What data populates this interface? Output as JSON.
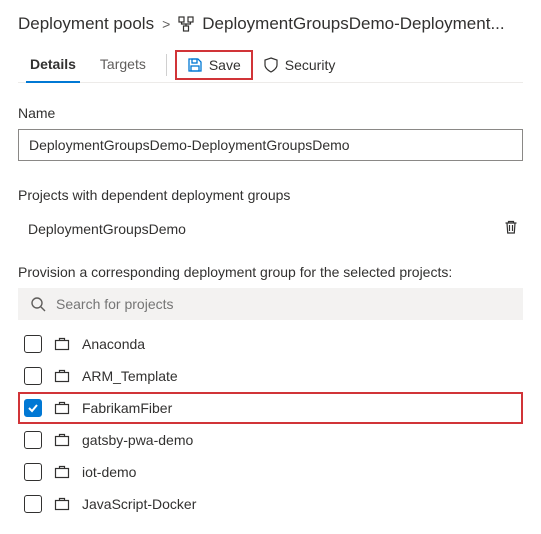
{
  "breadcrumb": {
    "root": "Deployment pools",
    "current": "DeploymentGroupsDemo-Deployment..."
  },
  "tabs": {
    "details": "Details",
    "targets": "Targets"
  },
  "toolbar": {
    "save": "Save",
    "security": "Security"
  },
  "nameSection": {
    "label": "Name",
    "value": "DeploymentGroupsDemo-DeploymentGroupsDemo"
  },
  "dependentSection": {
    "label": "Projects with dependent deployment groups",
    "items": [
      "DeploymentGroupsDemo"
    ]
  },
  "provisionSection": {
    "label": "Provision a corresponding deployment group for the selected projects:",
    "searchPlaceholder": "Search for projects",
    "projects": [
      {
        "name": "Anaconda",
        "checked": false
      },
      {
        "name": "ARM_Template",
        "checked": false
      },
      {
        "name": "FabrikamFiber",
        "checked": true,
        "highlighted": true
      },
      {
        "name": "gatsby-pwa-demo",
        "checked": false
      },
      {
        "name": "iot-demo",
        "checked": false
      },
      {
        "name": "JavaScript-Docker",
        "checked": false
      }
    ]
  }
}
